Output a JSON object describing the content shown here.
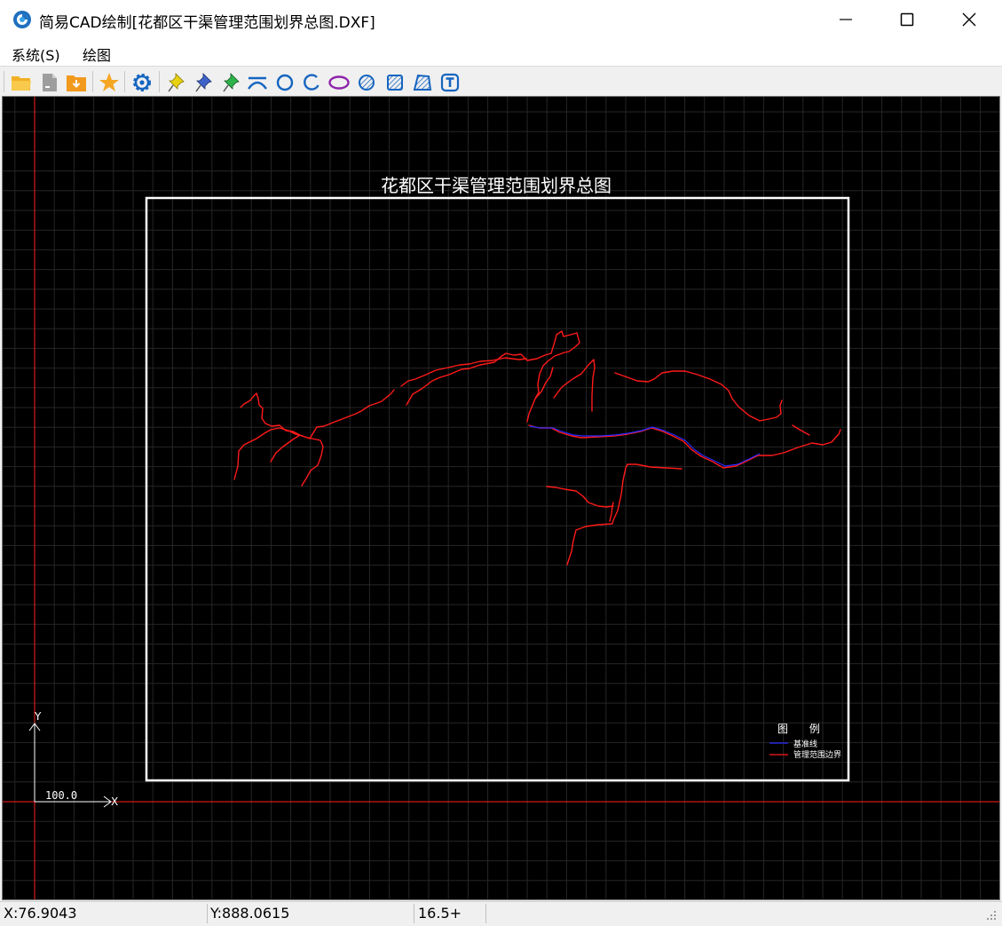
{
  "window": {
    "title": "简易CAD绘制[花都区干渠管理范围划界总图.DXF]"
  },
  "menu": {
    "items": [
      "系统(S)",
      "绘图"
    ]
  },
  "toolbar": {
    "buttons": [
      "open-folder-icon",
      "new-file-icon",
      "save-icon",
      "favorite-star-icon",
      "settings-gear-icon",
      "pin-yellow-icon",
      "pin-blue-icon",
      "pin-green-icon",
      "arc-icon",
      "circle-icon",
      "partial-arc-icon",
      "ellipse-icon",
      "hatch-circle-icon",
      "hatch-square-icon",
      "hatch-polygon-icon",
      "text-icon"
    ]
  },
  "drawing": {
    "title": "花都区干渠管理范围划界总图",
    "legend": {
      "title": "图 例",
      "items": [
        {
          "label": "基准线",
          "color": "#0000ff"
        },
        {
          "label": "管理范围边界",
          "color": "#ff0000"
        }
      ]
    },
    "scale_label": "100.0",
    "x_axis_label": "X",
    "y_axis_label": "Y"
  },
  "status": {
    "x": "X:76.9043",
    "y": "Y:888.0615",
    "zoom": "16.5+"
  },
  "colors": {
    "canvas_bg": "#000000",
    "grid": "#262626",
    "boundary": "#ff0000",
    "baseline": "#0000ff",
    "frame": "#ffffff"
  }
}
